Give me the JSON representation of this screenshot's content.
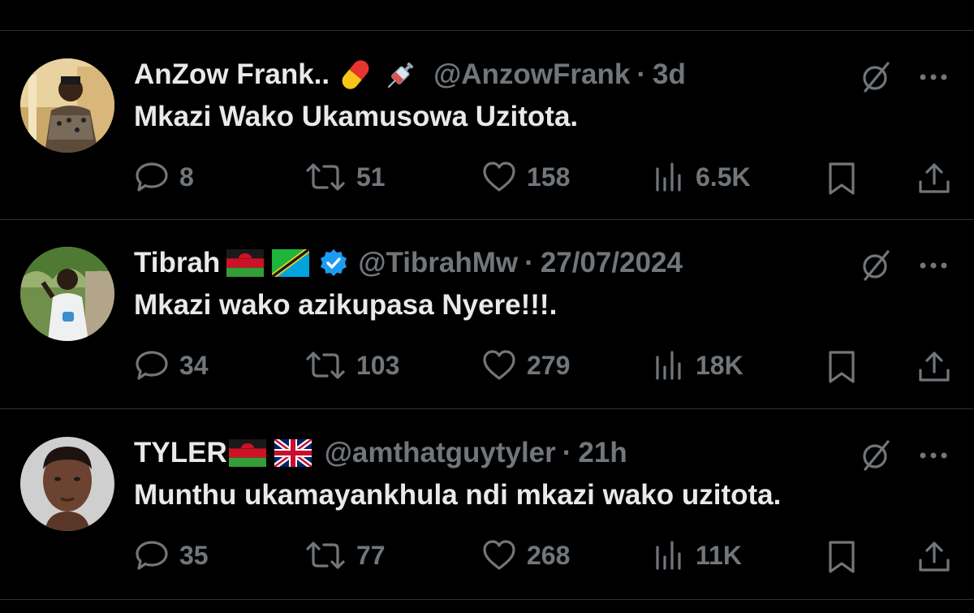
{
  "tweets": [
    {
      "name": "AnZow Frank..",
      "name_emojis": [
        "pill-emoji",
        "syringe-emoji"
      ],
      "verified": false,
      "handle": "@AnzowFrank",
      "separator": "·",
      "time": "3d",
      "text": "Mkazi Wako Ukamusowa Uzitota.",
      "replies": "8",
      "reposts": "51",
      "likes": "158",
      "views": "6.5K"
    },
    {
      "name": "Tibrah",
      "name_emojis": [
        "malawi-flag-emoji",
        "tanzania-flag-emoji"
      ],
      "verified": true,
      "handle": "@TibrahMw",
      "separator": "·",
      "time": "27/07/2024",
      "text": "Mkazi wako azikupasa Nyere!!!.",
      "replies": "34",
      "reposts": "103",
      "likes": "279",
      "views": "18K"
    },
    {
      "name": "TYLER",
      "name_emojis": [
        "malawi-flag-emoji",
        "uk-flag-emoji"
      ],
      "verified": false,
      "handle": "@amthatguytyler",
      "separator": "·",
      "time": "21h",
      "text": "Munthu ukamayankhula ndi mkazi wako uzitota.",
      "replies": "35",
      "reposts": "77",
      "likes": "268",
      "views": "11K"
    }
  ],
  "colors": {
    "background": "#000000",
    "primary_text": "#e7e9ea",
    "secondary_text": "#71767b",
    "divider": "#2f3336",
    "verified_blue": "#1d9bf0"
  },
  "icons": [
    "reply-icon",
    "repost-icon",
    "like-icon",
    "views-icon",
    "bookmark-icon",
    "share-icon",
    "grok-icon",
    "more-icon"
  ]
}
